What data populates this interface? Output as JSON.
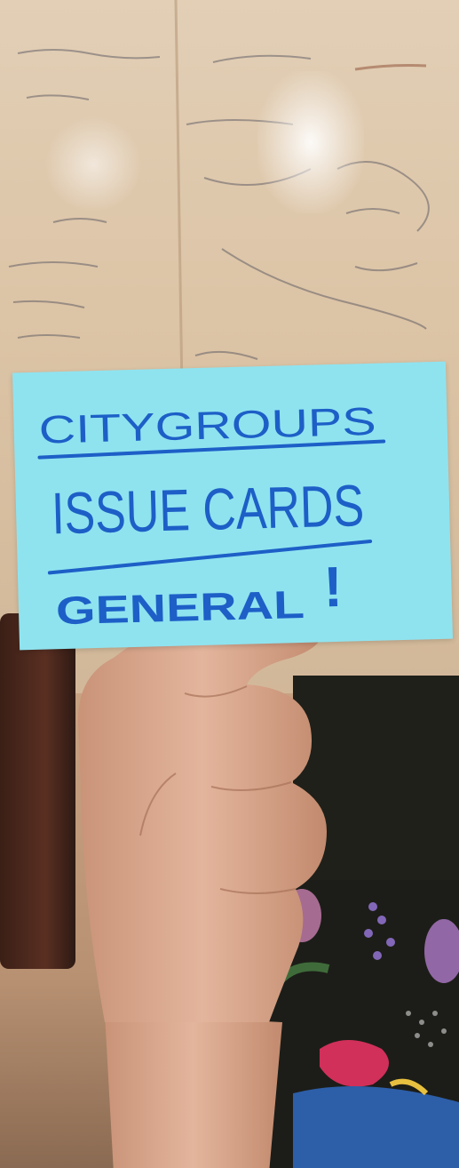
{
  "card": {
    "line1": "CITYGROUPS",
    "line2": "ISSUE CARDS",
    "line3": "GENERAL",
    "mark": "!"
  },
  "colors": {
    "card": "#8fe3ef",
    "ink": "#1d5fc7",
    "whiteboard": "#dcc4a6",
    "skin": "#d9a58a"
  }
}
